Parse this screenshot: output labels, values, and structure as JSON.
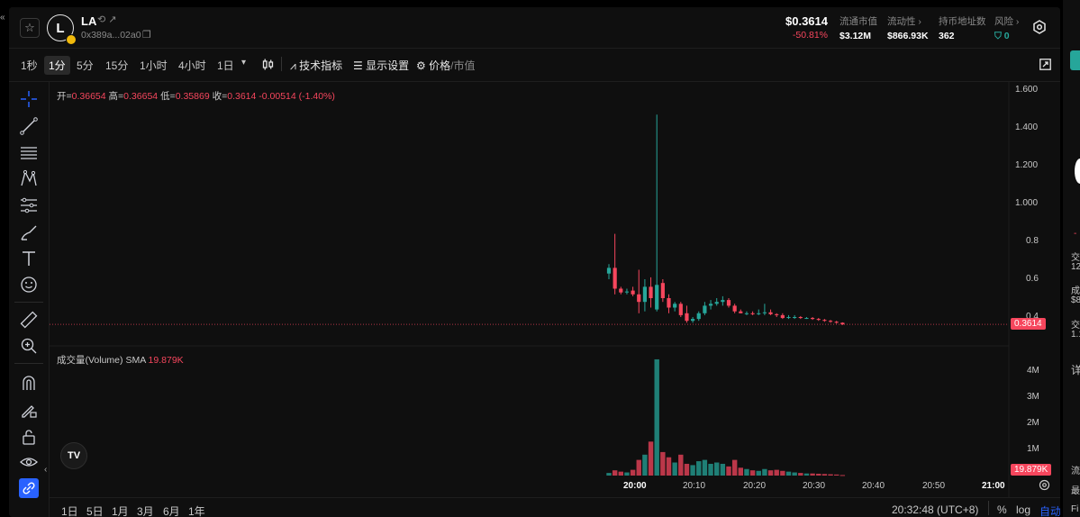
{
  "header": {
    "token_initial": "L",
    "token_name": "LA",
    "token_address": "0x389a...02a0",
    "price": "$0.3614",
    "price_change": "-50.81%",
    "stats": [
      {
        "label": "流通市值",
        "value": "$3.12M"
      },
      {
        "label": "流动性 ›",
        "value": "$866.93K"
      },
      {
        "label": "持币地址数",
        "value": "362"
      },
      {
        "label": "风险 ›",
        "value": "0"
      }
    ]
  },
  "toolbar": {
    "timeframes": [
      "1秒",
      "1分",
      "5分",
      "15分",
      "1小时",
      "4小时",
      "1日"
    ],
    "active_timeframe": "1分",
    "indicators_label": "技术指标",
    "display_label": "显示设置",
    "price_label": "价格",
    "mcap_label": "/市值"
  },
  "legend": {
    "open_label": "开=",
    "open": "0.36654",
    "high_label": "高=",
    "high": "0.36654",
    "low_label": "低=",
    "low": "0.35869",
    "close_label": "收=",
    "close": "0.3614",
    "change": "-0.00514 (-1.40%)",
    "volume_label": "成交量(Volume)",
    "volume_sma_label": "SMA",
    "volume_value": "19.879K"
  },
  "chart_data": {
    "type": "candlestick",
    "price_axis_ticks": [
      "1.600",
      "1.400",
      "1.200",
      "1.000",
      "0.8",
      "0.6",
      "0.4"
    ],
    "volume_axis_ticks": [
      "4M",
      "3M",
      "2M",
      "1M"
    ],
    "x_ticks": [
      "20:00",
      "20:10",
      "20:20",
      "20:30",
      "20:40",
      "20:50",
      "21:00"
    ],
    "last_price": "0.3614",
    "last_volume": "19.879K",
    "candles": [
      {
        "o": 0.63,
        "h": 0.68,
        "l": 0.6,
        "c": 0.66,
        "v": 0.1
      },
      {
        "o": 0.66,
        "h": 0.84,
        "l": 0.52,
        "c": 0.55,
        "v": 0.2
      },
      {
        "o": 0.55,
        "h": 0.56,
        "l": 0.52,
        "c": 0.53,
        "v": 0.15
      },
      {
        "o": 0.53,
        "h": 0.55,
        "l": 0.52,
        "c": 0.535,
        "v": 0.12
      },
      {
        "o": 0.54,
        "h": 0.56,
        "l": 0.51,
        "c": 0.52,
        "v": 0.22
      },
      {
        "o": 0.52,
        "h": 0.65,
        "l": 0.42,
        "c": 0.48,
        "v": 0.6
      },
      {
        "o": 0.48,
        "h": 0.6,
        "l": 0.43,
        "c": 0.56,
        "v": 0.8
      },
      {
        "o": 0.56,
        "h": 0.61,
        "l": 0.45,
        "c": 0.5,
        "v": 1.3
      },
      {
        "o": 0.44,
        "h": 1.47,
        "l": 0.43,
        "c": 0.57,
        "v": 4.45
      },
      {
        "o": 0.58,
        "h": 0.6,
        "l": 0.48,
        "c": 0.5,
        "v": 0.9
      },
      {
        "o": 0.5,
        "h": 0.52,
        "l": 0.42,
        "c": 0.45,
        "v": 0.7
      },
      {
        "o": 0.45,
        "h": 0.48,
        "l": 0.43,
        "c": 0.47,
        "v": 0.5
      },
      {
        "o": 0.47,
        "h": 0.48,
        "l": 0.4,
        "c": 0.41,
        "v": 0.8
      },
      {
        "o": 0.42,
        "h": 0.46,
        "l": 0.37,
        "c": 0.38,
        "v": 0.45
      },
      {
        "o": 0.38,
        "h": 0.4,
        "l": 0.37,
        "c": 0.39,
        "v": 0.4
      },
      {
        "o": 0.39,
        "h": 0.43,
        "l": 0.38,
        "c": 0.42,
        "v": 0.55
      },
      {
        "o": 0.42,
        "h": 0.48,
        "l": 0.41,
        "c": 0.46,
        "v": 0.6
      },
      {
        "o": 0.46,
        "h": 0.49,
        "l": 0.44,
        "c": 0.47,
        "v": 0.45
      },
      {
        "o": 0.47,
        "h": 0.5,
        "l": 0.46,
        "c": 0.48,
        "v": 0.5
      },
      {
        "o": 0.48,
        "h": 0.51,
        "l": 0.46,
        "c": 0.49,
        "v": 0.45
      },
      {
        "o": 0.49,
        "h": 0.5,
        "l": 0.45,
        "c": 0.46,
        "v": 0.35
      },
      {
        "o": 0.46,
        "h": 0.47,
        "l": 0.42,
        "c": 0.43,
        "v": 0.6
      },
      {
        "o": 0.43,
        "h": 0.44,
        "l": 0.42,
        "c": 0.42,
        "v": 0.3
      },
      {
        "o": 0.42,
        "h": 0.43,
        "l": 0.41,
        "c": 0.42,
        "v": 0.25
      },
      {
        "o": 0.42,
        "h": 0.43,
        "l": 0.41,
        "c": 0.415,
        "v": 0.2
      },
      {
        "o": 0.415,
        "h": 0.44,
        "l": 0.41,
        "c": 0.42,
        "v": 0.18
      },
      {
        "o": 0.42,
        "h": 0.47,
        "l": 0.41,
        "c": 0.425,
        "v": 0.25
      },
      {
        "o": 0.425,
        "h": 0.44,
        "l": 0.41,
        "c": 0.415,
        "v": 0.2
      },
      {
        "o": 0.415,
        "h": 0.42,
        "l": 0.4,
        "c": 0.41,
        "v": 0.22
      },
      {
        "o": 0.41,
        "h": 0.42,
        "l": 0.39,
        "c": 0.395,
        "v": 0.18
      },
      {
        "o": 0.395,
        "h": 0.41,
        "l": 0.39,
        "c": 0.4,
        "v": 0.15
      },
      {
        "o": 0.4,
        "h": 0.41,
        "l": 0.39,
        "c": 0.4,
        "v": 0.12
      },
      {
        "o": 0.4,
        "h": 0.405,
        "l": 0.39,
        "c": 0.395,
        "v": 0.1
      },
      {
        "o": 0.395,
        "h": 0.4,
        "l": 0.39,
        "c": 0.395,
        "v": 0.08
      },
      {
        "o": 0.395,
        "h": 0.4,
        "l": 0.385,
        "c": 0.39,
        "v": 0.08
      },
      {
        "o": 0.39,
        "h": 0.395,
        "l": 0.38,
        "c": 0.385,
        "v": 0.07
      },
      {
        "o": 0.385,
        "h": 0.39,
        "l": 0.375,
        "c": 0.38,
        "v": 0.06
      },
      {
        "o": 0.38,
        "h": 0.385,
        "l": 0.37,
        "c": 0.375,
        "v": 0.05
      },
      {
        "o": 0.375,
        "h": 0.38,
        "l": 0.365,
        "c": 0.37,
        "v": 0.04
      },
      {
        "o": 0.37,
        "h": 0.372,
        "l": 0.358,
        "c": 0.3614,
        "v": 0.02
      }
    ]
  },
  "colors": {
    "up": "#26a69a",
    "down": "#f6465d",
    "accent": "#2962ff"
  },
  "bottom": {
    "ranges": [
      "1日",
      "5日",
      "1月",
      "3月",
      "6月",
      "1年"
    ],
    "clock": "20:32:48 (UTC+8)",
    "pct": "%",
    "log": "log",
    "auto": "自动"
  },
  "right_panel": {
    "rows": [
      "交",
      "12",
      "成",
      "$8",
      "交",
      "1.1",
      "详",
      "流",
      "最",
      "Fi"
    ]
  },
  "tv_logo": "TV"
}
